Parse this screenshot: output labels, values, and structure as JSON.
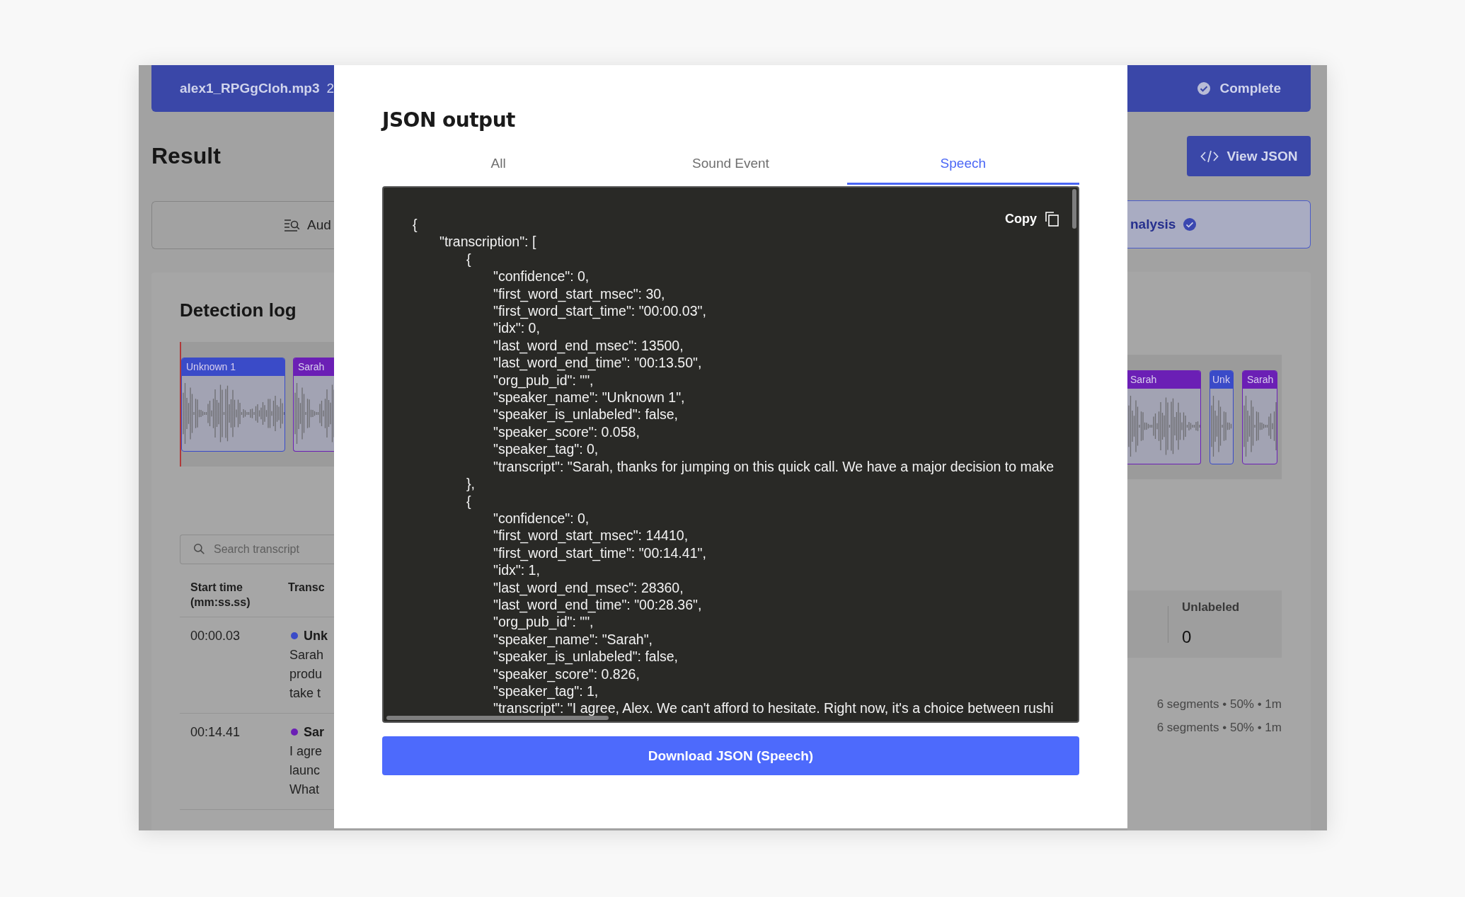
{
  "background": {
    "file_bar": {
      "filename": "alex1_RPGgCloh.mp3",
      "extra": "2",
      "status": "Complete"
    },
    "title": "Result",
    "view_json_button": "View JSON",
    "analysis_tabs": [
      {
        "label": "Aud",
        "selected": false
      },
      {
        "label": "nalysis",
        "selected": true
      }
    ],
    "detection_log": {
      "title": "Detection log",
      "left_clips": [
        {
          "label": "Unknown 1",
          "color": "#3a4bc8"
        },
        {
          "label": "Sarah",
          "color": "#6b1fb5"
        }
      ],
      "right_clips": [
        {
          "label": "Sarah",
          "color": "#6b1fb5"
        },
        {
          "label": "Unk",
          "color": "#3a4bc8"
        },
        {
          "label": "Sarah",
          "color": "#6b1fb5"
        }
      ]
    },
    "search": {
      "placeholder": "Search transcript"
    },
    "table": {
      "columns": [
        "Start time\n(mm:ss.ss)",
        "Transc"
      ],
      "rows": [
        {
          "start": "00:00.03",
          "speaker": "Unk",
          "color": "#3a4bc8",
          "lines": [
            "Sarah",
            "produ",
            "take t"
          ]
        },
        {
          "start": "00:14.41",
          "speaker": "Sar",
          "color": "#6b1fb5",
          "lines": [
            "I agre",
            "launc",
            "What"
          ]
        }
      ]
    },
    "stats": {
      "label": "Unlabeled",
      "value": "0"
    },
    "segment_summaries": [
      "6 segments • 50% • 1m",
      "6 segments • 50% • 1m"
    ]
  },
  "modal": {
    "title": "JSON output",
    "tabs": [
      {
        "label": "All",
        "selected": false
      },
      {
        "label": "Sound Event",
        "selected": false
      },
      {
        "label": "Speech",
        "selected": true
      }
    ],
    "copy_label": "Copy",
    "code_lines": [
      "{",
      "\t\"transcription\": [",
      "\t\t{",
      "\t\t\t\"confidence\": 0,",
      "\t\t\t\"first_word_start_msec\": 30,",
      "\t\t\t\"first_word_start_time\": \"00:00.03\",",
      "\t\t\t\"idx\": 0,",
      "\t\t\t\"last_word_end_msec\": 13500,",
      "\t\t\t\"last_word_end_time\": \"00:13.50\",",
      "\t\t\t\"org_pub_id\": \"\",",
      "\t\t\t\"speaker_name\": \"Unknown 1\",",
      "\t\t\t\"speaker_is_unlabeled\": false,",
      "\t\t\t\"speaker_score\": 0.058,",
      "\t\t\t\"speaker_tag\": 0,",
      "\t\t\t\"transcript\": \"Sarah, thanks for jumping on this quick call. We have a major decision to make",
      "\t\t},",
      "\t\t{",
      "\t\t\t\"confidence\": 0,",
      "\t\t\t\"first_word_start_msec\": 14410,",
      "\t\t\t\"first_word_start_time\": \"00:14.41\",",
      "\t\t\t\"idx\": 1,",
      "\t\t\t\"last_word_end_msec\": 28360,",
      "\t\t\t\"last_word_end_time\": \"00:28.36\",",
      "\t\t\t\"org_pub_id\": \"\",",
      "\t\t\t\"speaker_name\": \"Sarah\",",
      "\t\t\t\"speaker_is_unlabeled\": false,",
      "\t\t\t\"speaker_score\": 0.826,",
      "\t\t\t\"speaker_tag\": 1,",
      "\t\t\t\"transcript\": \"I agree, Alex. We can't afford to hesitate. Right now, it's a choice between rushi"
    ],
    "download_button": "Download JSON (Speech)"
  }
}
